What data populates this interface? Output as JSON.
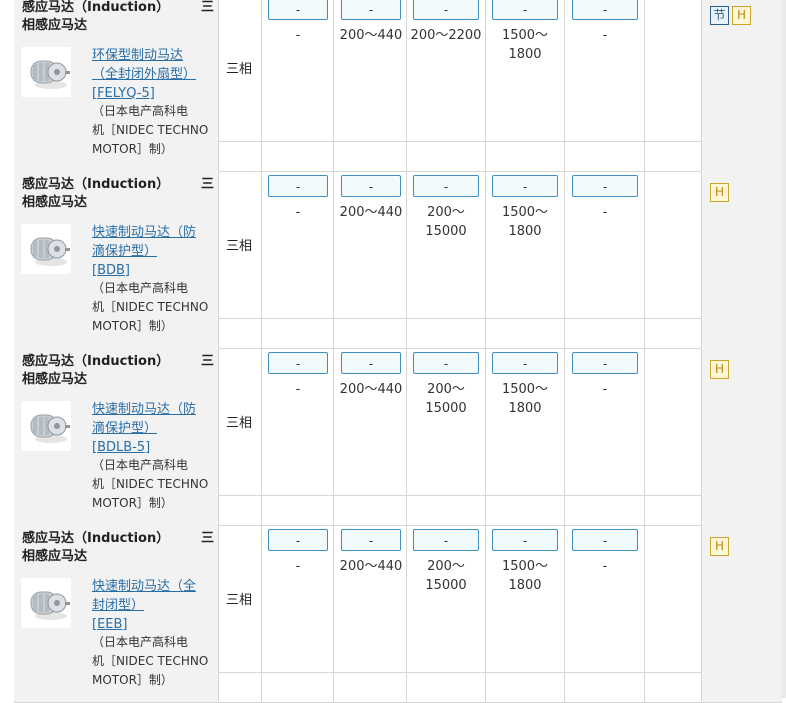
{
  "products": [
    {
      "title_main": "感应马达（Induction）",
      "title_tail": "三",
      "title_line2": "相感应马达",
      "link_lines": [
        "环保型制动马达",
        "（全封闭外扇型）",
        "[FELYQ-5]"
      ],
      "mfr_lines": [
        "（日本电产高科电",
        "机［NIDEC TECHNO",
        "MOTOR］制）"
      ],
      "phase": "三相",
      "values": [
        [
          "-"
        ],
        [
          "200～440"
        ],
        [
          "200～2200"
        ],
        [
          "1500～",
          "1800"
        ],
        [
          "-"
        ]
      ],
      "badges": [
        "节",
        "H"
      ]
    },
    {
      "title_main": "感应马达（Induction）",
      "title_tail": "三",
      "title_line2": "相感应马达",
      "link_lines": [
        "快速制动马达（防",
        "滴保护型）",
        "[BDB]"
      ],
      "mfr_lines": [
        "（日本电产高科电",
        "机［NIDEC TECHNO",
        "MOTOR］制）"
      ],
      "phase": "三相",
      "values": [
        [
          "-"
        ],
        [
          "200～440"
        ],
        [
          "200～",
          "15000"
        ],
        [
          "1500～",
          "1800"
        ],
        [
          "-"
        ]
      ],
      "badges": [
        "H"
      ]
    },
    {
      "title_main": "感应马达（Induction）",
      "title_tail": "三",
      "title_line2": "相感应马达",
      "link_lines": [
        "快速制动马达（防",
        "滴保护型）",
        "[BDLB-5]"
      ],
      "mfr_lines": [
        "（日本电产高科电",
        "机［NIDEC TECHNO",
        "MOTOR］制）"
      ],
      "phase": "三相",
      "values": [
        [
          "-"
        ],
        [
          "200～440"
        ],
        [
          "200～",
          "15000"
        ],
        [
          "1500～",
          "1800"
        ],
        [
          "-"
        ]
      ],
      "badges": [
        "H"
      ]
    },
    {
      "title_main": "感应马达（Induction）",
      "title_tail": "三",
      "title_line2": "相感应马达",
      "link_lines": [
        "快速制动马达（全",
        "封闭型）",
        "[EEB]"
      ],
      "mfr_lines": [
        "（日本电产高科电",
        "机［NIDEC TECHNO",
        "MOTOR］制）"
      ],
      "phase": "三相",
      "values": [
        [
          "-"
        ],
        [
          "200～440"
        ],
        [
          "200～",
          "15000"
        ],
        [
          "1500～",
          "1800"
        ],
        [
          "-"
        ]
      ],
      "badges": [
        "H"
      ]
    }
  ],
  "dropdown_label": "-",
  "colors": {
    "link": "#2a6ea6",
    "dropdown_border": "#3d8fc2",
    "badge_h": "#c9a62a",
    "badge_jie": "#2c5f86"
  }
}
